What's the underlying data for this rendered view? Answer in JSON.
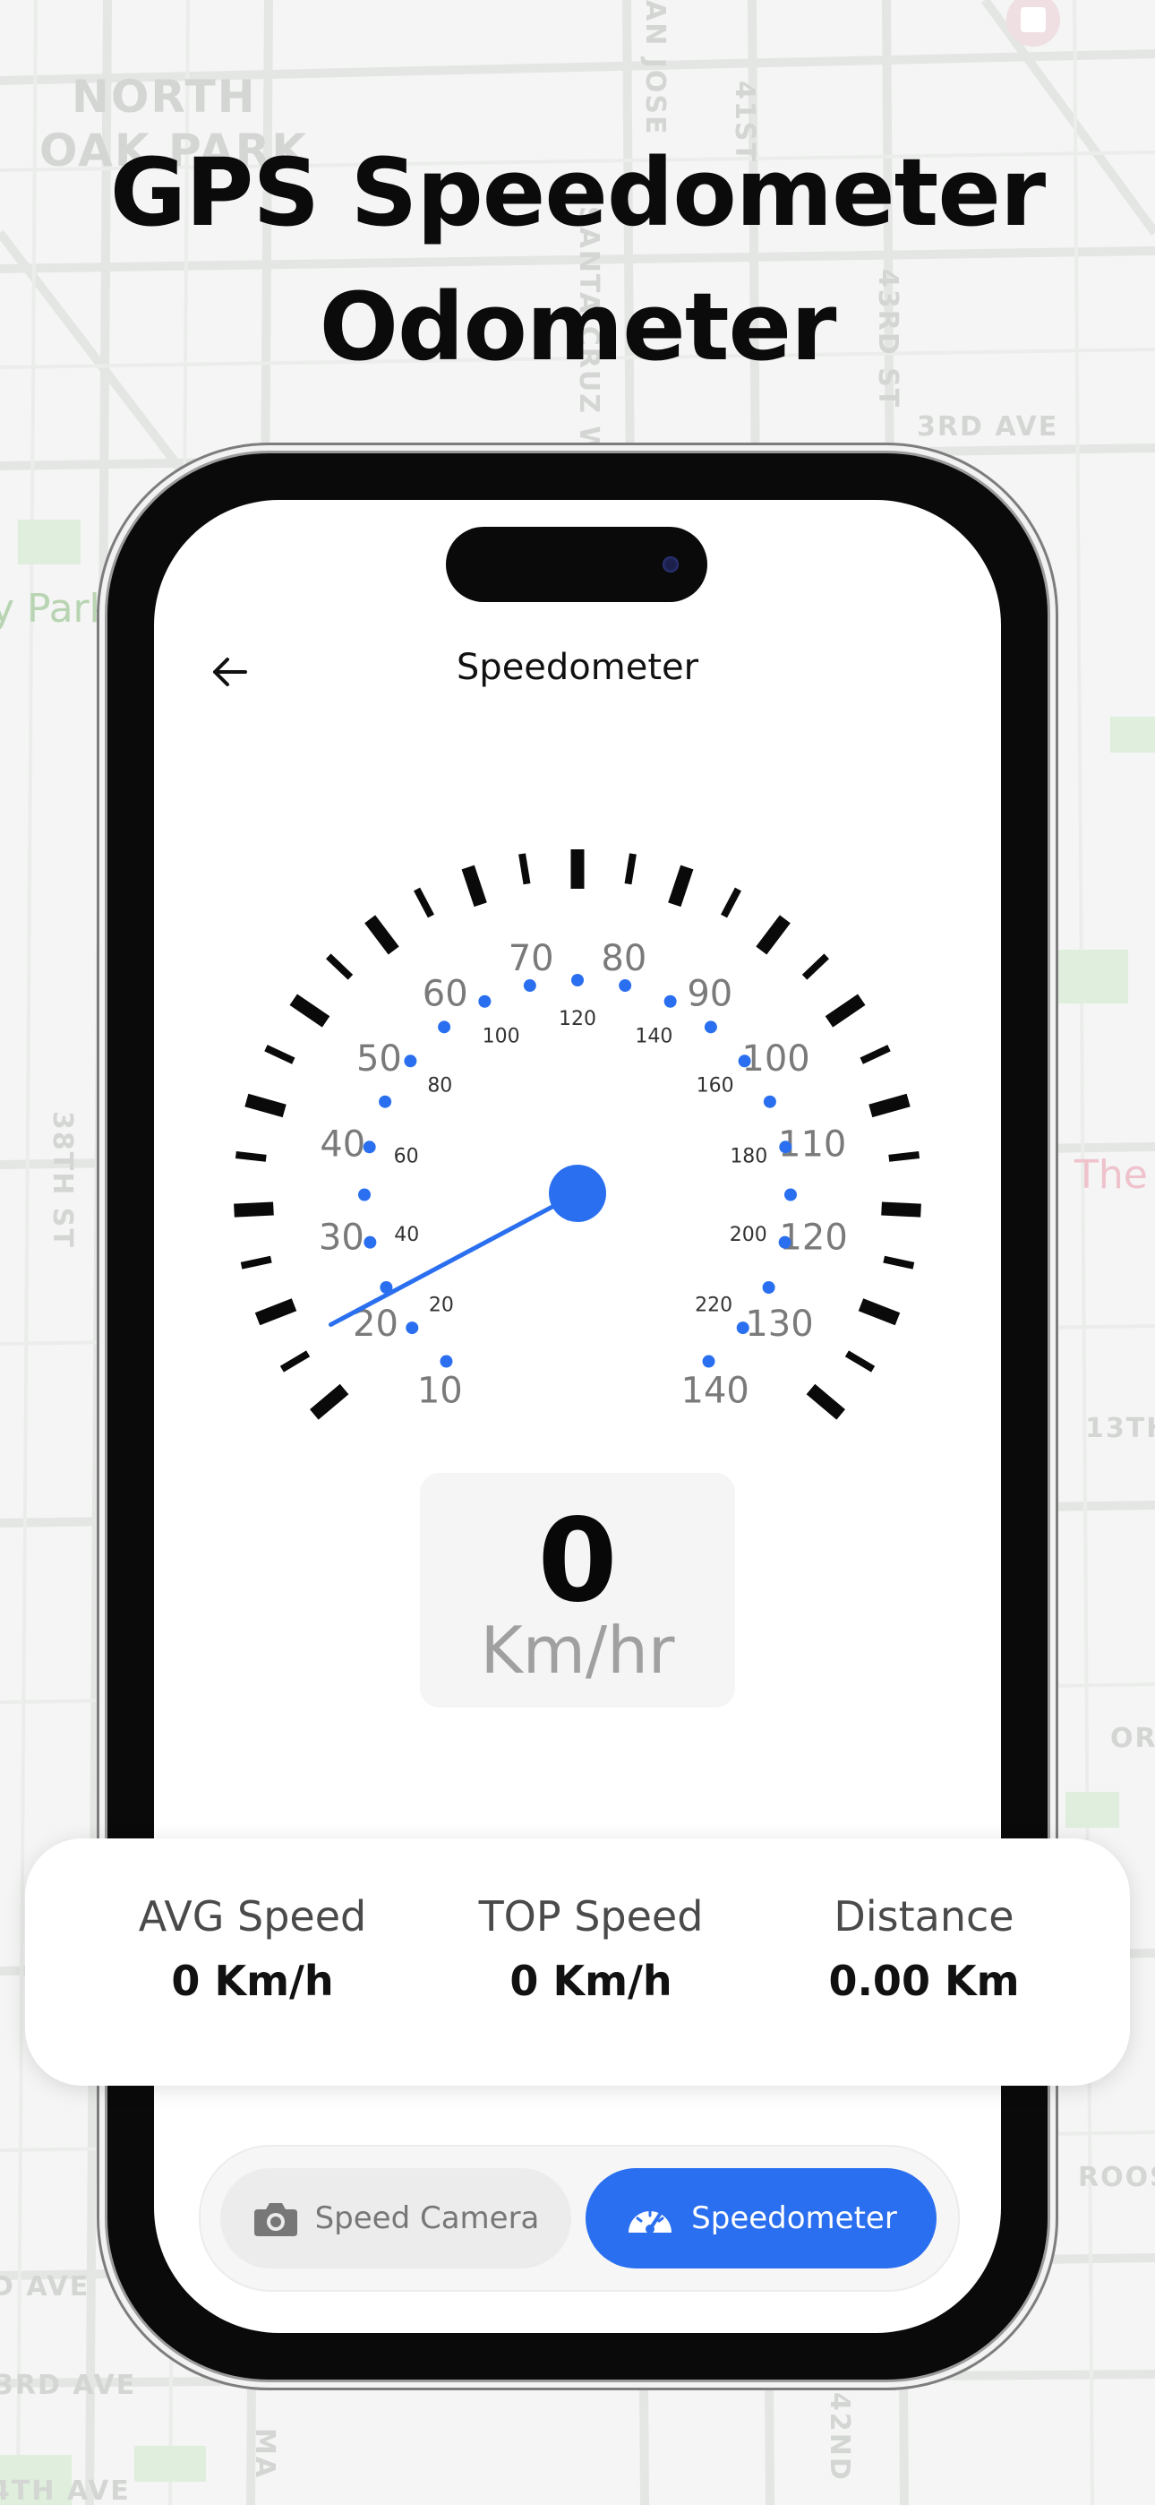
{
  "headline": {
    "line1": "GPS Speedometer",
    "line2": "Odometer"
  },
  "map_labels": {
    "north_oak_park_1": "NORTH",
    "north_oak_park_2": "OAK PARK",
    "y_park": "y Park",
    "san_jose_ave": "AN JOSE",
    "santa_cruz": "SANTA CRUZ W",
    "st41": "41ST",
    "st43": "43RD ST",
    "ave3": "3RD AVE",
    "st38": "38TH ST",
    "the": "The",
    "th13": "13TH",
    "or": "OR",
    "roos": "ROOS",
    "ave_bl": "D AVE",
    "ave3_bl": "3RD AVE",
    "th4_bl": "4TH AVE",
    "ma": "MA",
    "nd42": "42ND"
  },
  "screen": {
    "title": "Speedometer"
  },
  "icons": {
    "back": "back-arrow-icon",
    "camera": "camera-icon",
    "speedometer": "speedometer-icon",
    "map_pin": "map-pin-icon"
  },
  "colors": {
    "accent": "#2a6ff0",
    "needle": "#2a6ff0"
  },
  "gauge": {
    "outer_scale": [
      "10",
      "20",
      "30",
      "40",
      "50",
      "60",
      "70",
      "80",
      "90",
      "100",
      "110",
      "120",
      "130",
      "140"
    ],
    "inner_scale": [
      "20",
      "40",
      "60",
      "80",
      "100",
      "120",
      "140",
      "160",
      "180",
      "200",
      "220"
    ],
    "current_value": 0
  },
  "readout": {
    "value": "0",
    "unit": "Km/hr"
  },
  "stats": {
    "avg_label": "AVG Speed",
    "avg_value": "0 Km/h",
    "top_label": "TOP Speed",
    "top_value": "0 Km/h",
    "distance_label": "Distance",
    "distance_value": "0.00 Km"
  },
  "nav": {
    "camera_label": "Speed Camera",
    "speedo_label": "Speedometer",
    "active": "Speedometer"
  }
}
